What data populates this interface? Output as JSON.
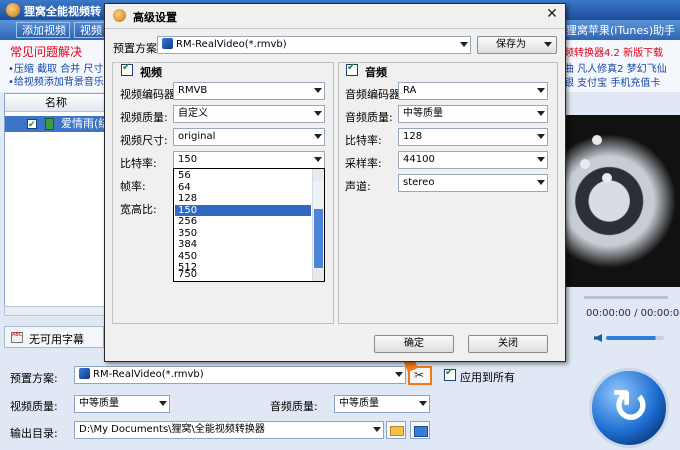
{
  "main": {
    "title": "狸窝全能视频转",
    "itunes_link": "狸窝苹果(iTunes)助手",
    "toolbar": {
      "add_video": "添加视频",
      "second_btn": "视频"
    },
    "faq": {
      "title": "常见问题解决",
      "lines": [
        "•压缩 截取 合并 尺寸",
        "•给视频添加背景音乐"
      ]
    },
    "promo": {
      "red": "频转换器4.2 新版下载",
      "line1": "曲  凡人修真2  梦幻飞仙",
      "line2": "银  支付宝  手机充值卡"
    },
    "list": {
      "header": "名称",
      "row_name": "爱情雨(结局"
    },
    "subtitle": "无可用字幕",
    "time_display": "00:00:00 / 00:00:00",
    "bottom": {
      "preset_label": "预置方案:",
      "preset_value": "RM-RealVideo(*.rmvb)",
      "apply_all": "应用到所有",
      "video_quality_label": "视频质量:",
      "video_quality_value": "中等质量",
      "audio_quality_label": "音频质量:",
      "audio_quality_value": "中等质量",
      "output_label": "输出目录:",
      "output_value": "D:\\My Documents\\狸窝\\全能视频转换器"
    },
    "colors": {
      "accent": "#2f66b3",
      "annotation": "#f07a1a",
      "selection": "#3168c6"
    }
  },
  "dialog": {
    "title": "高级设置",
    "preset_label": "预置方案:",
    "preset_value": "RM-RealVideo(*.rmvb)",
    "save_as": "保存为",
    "video": {
      "group_title": "视频",
      "encoder_label": "视频编码器:",
      "encoder_value": "RMVB",
      "quality_label": "视频质量:",
      "quality_value": "自定义",
      "size_label": "视频尺寸:",
      "size_value": "original",
      "bitrate_label": "比特率:",
      "bitrate_value": "150",
      "framerate_label": "帧率:",
      "aspect_label": "宽高比:"
    },
    "audio": {
      "group_title": "音频",
      "encoder_label": "音频编码器:",
      "encoder_value": "RA",
      "quality_label": "音频质量:",
      "quality_value": "中等质量",
      "bitrate_label": "比特率:",
      "bitrate_value": "128",
      "samplerate_label": "采样率:",
      "samplerate_value": "44100",
      "channel_label": "声道:",
      "channel_value": "stereo"
    },
    "bitrate_options": [
      "56",
      "64",
      "128",
      "150",
      "256",
      "350",
      "384",
      "450",
      "512",
      "750"
    ],
    "bitrate_selected_index": 3,
    "ok": "确定",
    "close": "关闭"
  }
}
